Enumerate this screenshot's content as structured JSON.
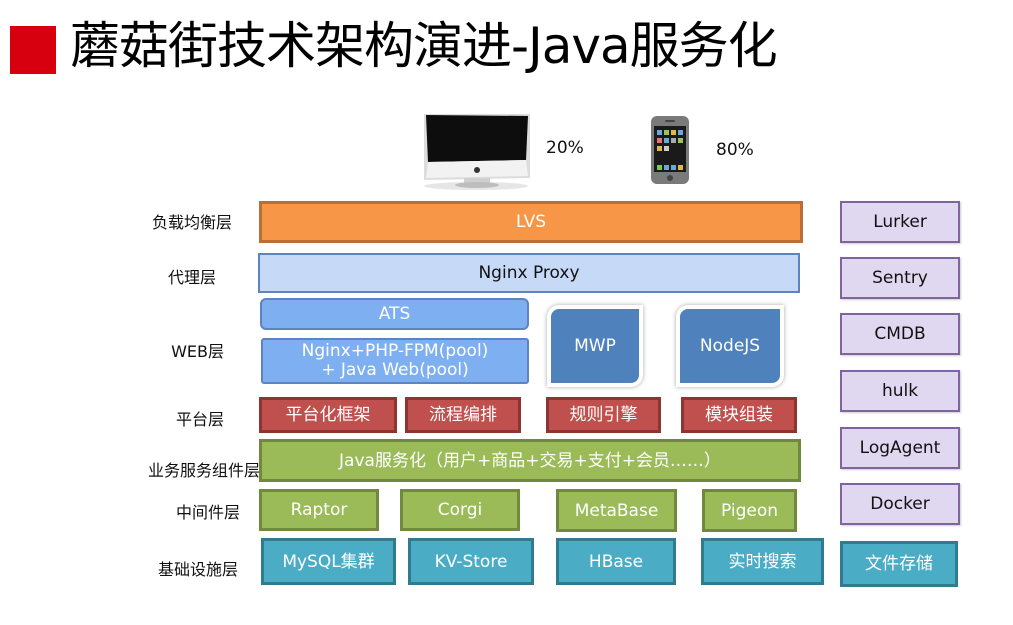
{
  "title": "蘑菇街技术架构演进-Java服务化",
  "clients": [
    {
      "icon": "desktop-computer-icon",
      "share": "20%"
    },
    {
      "icon": "mobile-phone-icon",
      "share": "80%"
    }
  ],
  "layers": {
    "load_balance": {
      "label": "负载均衡层",
      "boxes": [
        "LVS"
      ]
    },
    "proxy": {
      "label": "代理层",
      "boxes": [
        "Nginx Proxy"
      ]
    },
    "web": {
      "label": "WEB层",
      "ats": "ATS",
      "pool_line1": "Nginx+PHP-FPM(pool)",
      "pool_line2": "+  Java Web(pool)",
      "tiles": [
        "MWP",
        "NodeJS"
      ]
    },
    "platform": {
      "label": "平台层",
      "boxes": [
        "平台化框架",
        "流程编排",
        "规则引擎",
        "模块组装"
      ]
    },
    "business": {
      "label": "业务服务组件层",
      "boxes": [
        "Java服务化（用户+商品+交易+支付+会员……）"
      ]
    },
    "middleware": {
      "label": "中间件层",
      "boxes": [
        "Raptor",
        "Corgi",
        "MetaBase",
        "Pigeon"
      ]
    },
    "infrastructure": {
      "label": "基础设施层",
      "boxes": [
        "MySQL集群",
        "KV-Store",
        "HBase",
        "实时搜索",
        "文件存储"
      ]
    }
  },
  "side_tools": [
    "Lurker",
    "Sentry",
    "CMDB",
    "hulk",
    "LogAgent",
    "Docker"
  ],
  "colors": {
    "title_accent": "#d7000f",
    "load_balance": "#f79646",
    "proxy": "#c6d9f7",
    "web": "#7eaff0",
    "web_tiles": "#4f81bd",
    "platform": "#c0504d",
    "business": "#9bbb59",
    "middleware": "#9bbb59",
    "infrastructure": "#4bacc6",
    "side_tools": "#e0d7f0"
  }
}
